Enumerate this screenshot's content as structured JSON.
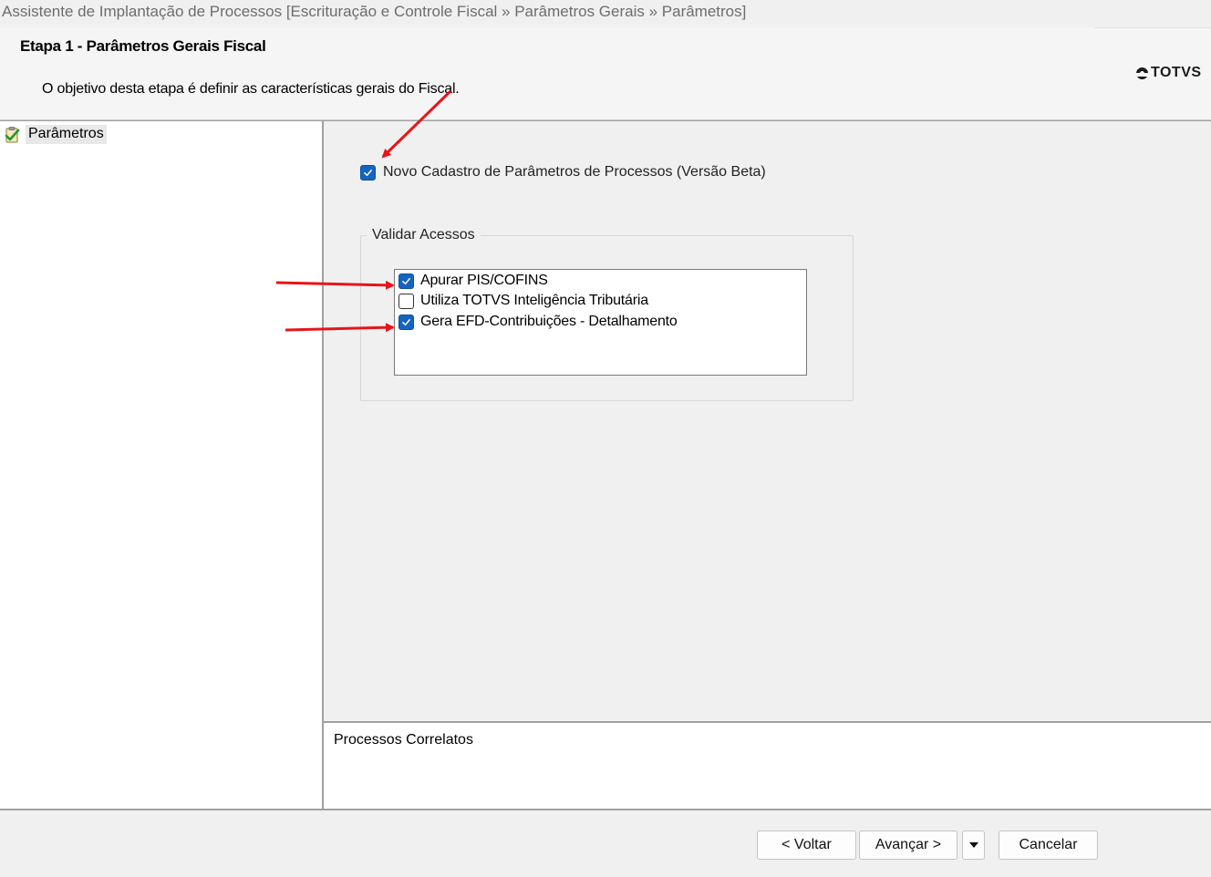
{
  "window": {
    "title": "Assistente de Implantação de Processos [Escrituração e Controle Fiscal » Parâmetros Gerais » Parâmetros]"
  },
  "header": {
    "step_title": "Etapa 1 - Parâmetros Gerais Fiscal",
    "description": "O objetivo desta etapa é definir as características gerais do Fiscal.",
    "logo_text": "TOTVS"
  },
  "sidebar": {
    "items": [
      {
        "label": "Parâmetros",
        "icon": "checklist-icon"
      }
    ]
  },
  "main": {
    "beta_checkbox": {
      "label": "Novo Cadastro de Parâmetros de Processos (Versão Beta)",
      "checked": true
    },
    "group": {
      "legend": "Validar Acessos",
      "items": [
        {
          "label": "Apurar PIS/COFINS",
          "checked": true
        },
        {
          "label": "Utiliza TOTVS Inteligência Tributária",
          "checked": false
        },
        {
          "label": "Gera EFD-Contribuições - Detalhamento",
          "checked": true
        }
      ]
    }
  },
  "related": {
    "label": "Processos Correlatos"
  },
  "footer": {
    "back_label": "< Voltar",
    "next_label": "Avançar >",
    "cancel_label": "Cancelar"
  },
  "colors": {
    "checkbox_checked": "#1565c0",
    "annotation_arrow": "#e8141a"
  }
}
